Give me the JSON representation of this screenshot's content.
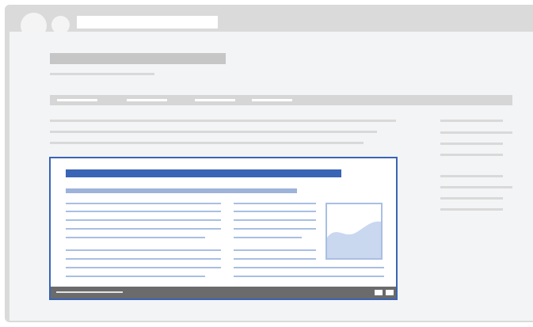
{
  "window": {
    "address_bar": "",
    "page_title": ""
  },
  "nav": {
    "links": [
      "",
      "",
      "",
      ""
    ]
  },
  "embed": {
    "title": "",
    "subtitle": ""
  },
  "colors": {
    "accent": "#3a64b5",
    "embed_line": "#a9bfe3",
    "placeholder_gray": "#cdcdcd",
    "footer": "#6b6b6b",
    "page_bg": "#f3f4f5"
  },
  "icons": {
    "window_controls": [
      "window-dot-icon",
      "window-dot-icon"
    ],
    "thumbnail": "wave-image-icon",
    "footer_buttons": [
      "fullscreen-icon",
      "expand-icon"
    ]
  }
}
